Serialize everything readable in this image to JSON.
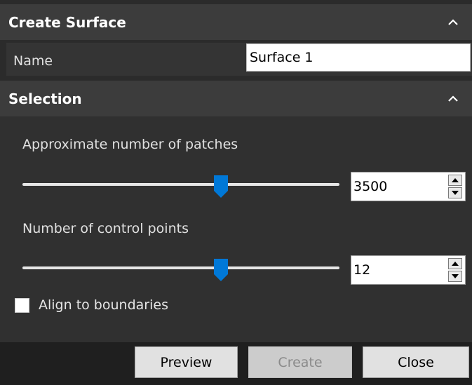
{
  "create_surface": {
    "title": "Create Surface",
    "chevron_icon": "chevron-up-icon",
    "name_label": "Name",
    "name_value": "Surface 1"
  },
  "selection": {
    "title": "Selection",
    "chevron_icon": "chevron-up-icon",
    "patches": {
      "label": "Approximate number of patches",
      "value": "3500",
      "slider_fraction": 0.627
    },
    "control_points": {
      "label": "Number of control points",
      "value": "12",
      "slider_fraction": 0.625
    },
    "align_checkbox": {
      "label": "Align to boundaries",
      "checked": false
    }
  },
  "footer": {
    "preview_label": "Preview",
    "create_label": "Create",
    "close_label": "Close",
    "create_enabled": false
  },
  "colors": {
    "accent": "#0078d7",
    "background": "#2b2b2b",
    "header_bg": "#3c3c3c",
    "footer_bg": "#1f1f1f"
  }
}
